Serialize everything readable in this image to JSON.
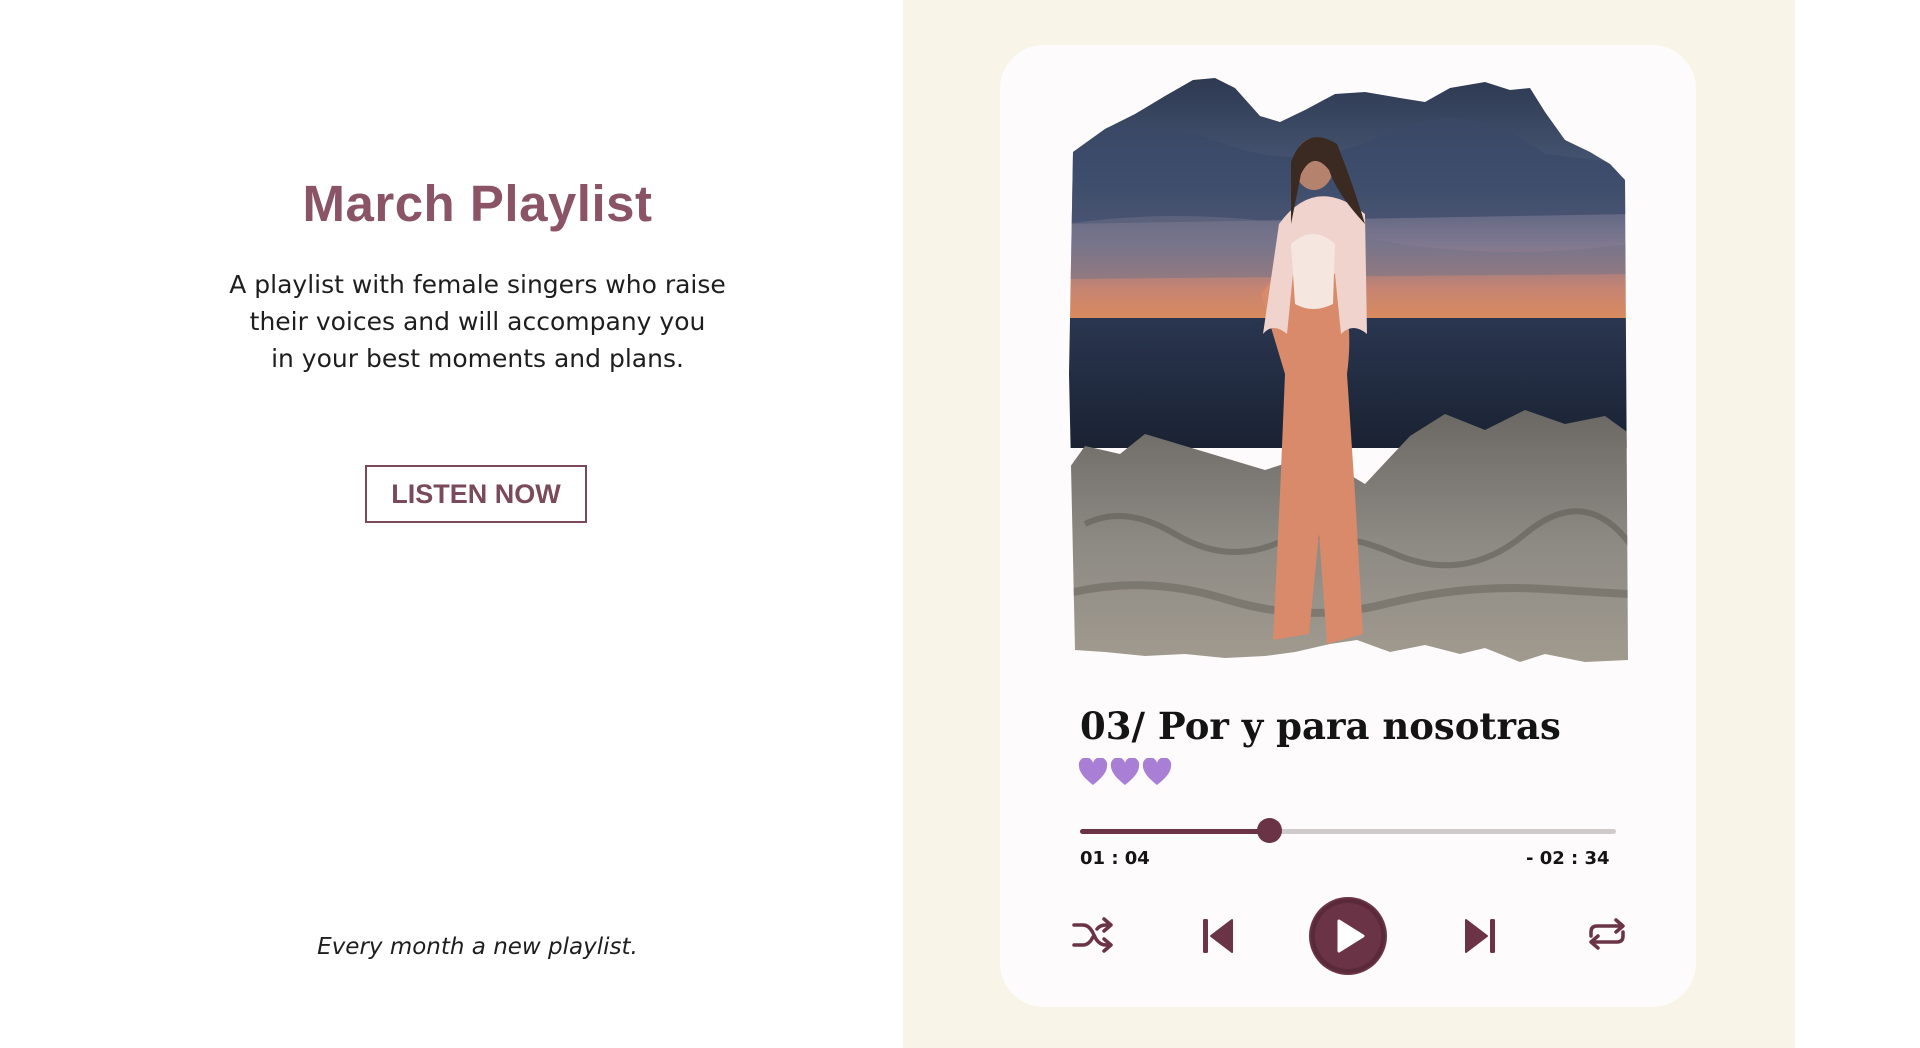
{
  "promo": {
    "title": "March Playlist",
    "description_lines": [
      "A playlist with female singers who raise",
      "their voices and will accompany you",
      "in your best moments and plans."
    ],
    "cta_label": "LISTEN NOW",
    "tagline": "Every month a new playlist."
  },
  "player": {
    "track_title": "03/ Por y para nosotras",
    "hearts": 3,
    "elapsed": "01 : 04",
    "remaining": "- 02 : 34",
    "progress": 0.354,
    "controls": [
      "shuffle-icon",
      "previous-icon",
      "play-icon",
      "next-icon",
      "repeat-icon"
    ]
  },
  "colors": {
    "accent": "#6a3446",
    "title": "#8a5466",
    "heart": "#a97fd6",
    "panel_bg": "#f8f5e8",
    "card_bg": "#fdfbfb"
  }
}
